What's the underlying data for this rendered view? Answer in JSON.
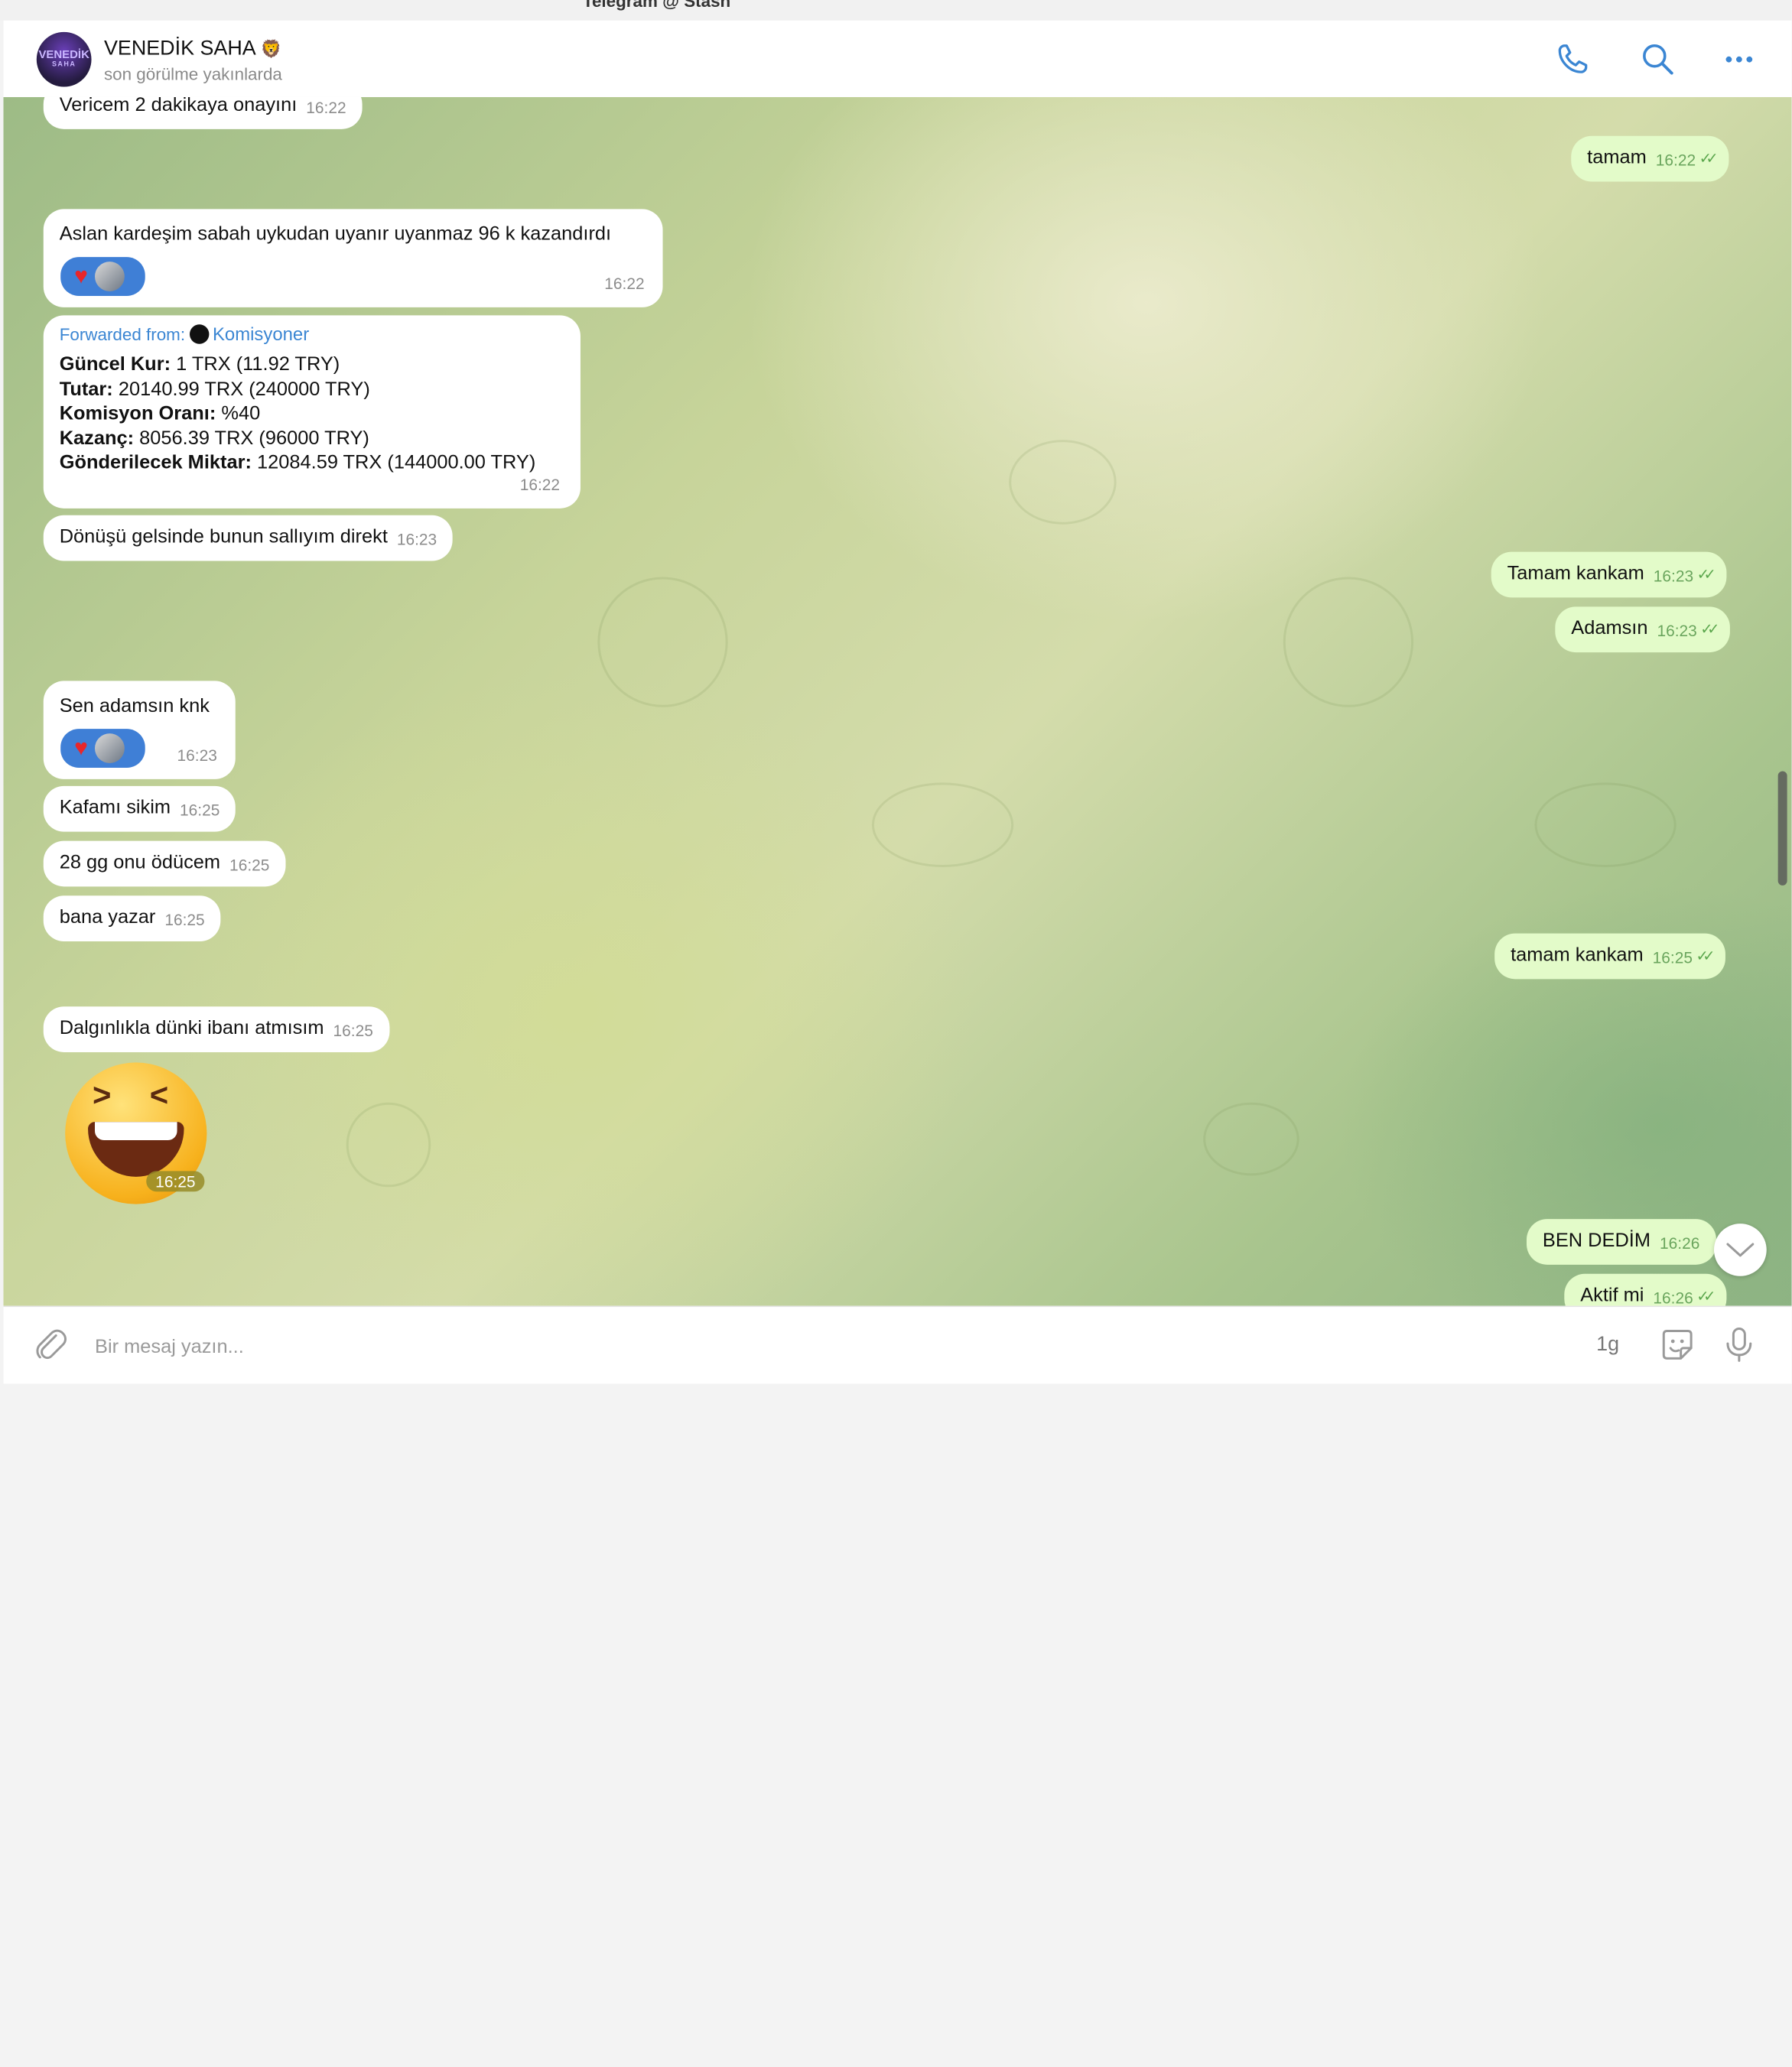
{
  "window": {
    "title": "Telegram @ Stash"
  },
  "header": {
    "avatar": {
      "line1": "VENEDİK",
      "line2": "SAHA"
    },
    "name": "VENEDİK SAHA",
    "status": "son görülme yakınlarda"
  },
  "messages": [
    {
      "dir": "in",
      "text": "Vericem 2 dakikaya onayını",
      "time": "16:22"
    },
    {
      "dir": "out",
      "text": "tamam",
      "time": "16:22"
    },
    {
      "dir": "in",
      "text": "Aslan kardeşim sabah uykudan uyanır uyanmaz 96 k kazandırdı",
      "time": "16:22"
    },
    {
      "dir": "in",
      "text": "Dönüşü gelsinde bunun sallıyım direkt",
      "time": "16:23"
    },
    {
      "dir": "out",
      "text": "Tamam kankam",
      "time": "16:23"
    },
    {
      "dir": "out",
      "text": "Adamsın",
      "time": "16:23"
    },
    {
      "dir": "in",
      "text": "Sen adamsın knk",
      "time": "16:23"
    },
    {
      "dir": "in",
      "text": "Kafamı sikim",
      "time": "16:25"
    },
    {
      "dir": "in",
      "text": "28 gg onu ödücem",
      "time": "16:25"
    },
    {
      "dir": "in",
      "text": "bana yazar",
      "time": "16:25"
    },
    {
      "dir": "out",
      "text": "tamam kankam",
      "time": "16:25"
    },
    {
      "dir": "in",
      "text": "Dalgınlıkla dünki ibanı atmısım",
      "time": "16:25"
    },
    {
      "dir": "out",
      "text": "BEN DEDİM",
      "time": "16:26"
    },
    {
      "dir": "out",
      "text": "Aktif mi",
      "time": "16:26"
    }
  ],
  "forwarded": {
    "label": "Forwarded from:",
    "from": "Komisyoner",
    "time": "16:22",
    "lines": [
      {
        "key": "Güncel Kur:",
        "value": "1 TRX (11.92 TRY)"
      },
      {
        "key": "Tutar:",
        "value": "20140.99 TRX (240000 TRY)"
      },
      {
        "key": "Komisyon Oranı:",
        "value": "%40"
      },
      {
        "key": "Kazanç:",
        "value": "8056.39 TRX (96000 TRY)"
      },
      {
        "key": "Gönderilecek Miktar:",
        "value": "12084.59 TRX (144000.00 TRY)"
      }
    ]
  },
  "sticker": {
    "time": "16:25"
  },
  "composer": {
    "placeholder": "Bir mesaj yazın...",
    "duration": "1g"
  },
  "icons": {
    "call": "phone-icon",
    "search": "search-icon",
    "more": "more-icon",
    "attach": "paperclip-icon",
    "sticker": "sticker-icon",
    "mic": "microphone-icon",
    "heart": "heart-icon",
    "tick": "double-check-icon"
  },
  "colors": {
    "accent": "#3b86d3",
    "outgoing": "#e3fbc9",
    "incoming": "#ffffff",
    "reaction": "#3f7fd6"
  }
}
